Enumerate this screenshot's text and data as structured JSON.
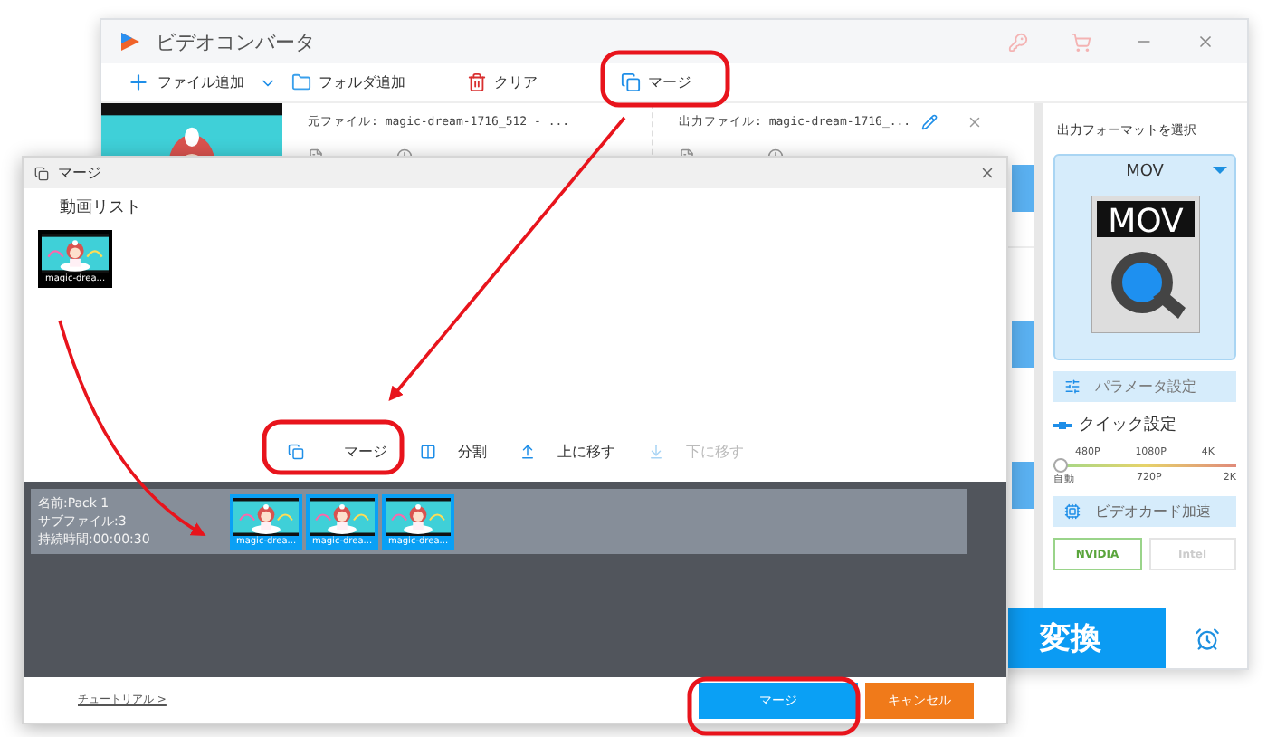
{
  "main_window": {
    "title": "ビデオコンバータ",
    "toolbar": [
      {
        "kind": "add",
        "label": "ファイル追加"
      },
      {
        "kind": "folder",
        "label": "フォルダ追加"
      },
      {
        "kind": "clear",
        "label": "クリア"
      },
      {
        "kind": "merge",
        "label": "マージ"
      }
    ],
    "file": {
      "source": "元ファイル: magic-dream-1716_512 - ...",
      "output": "出力ファイル: magic-dream-1716_..."
    },
    "format_panel": {
      "heading": "出力フォーマットを選択",
      "format": "MOV",
      "format_icon_text": "MOV",
      "params_button": "パラメータ設定",
      "quick_heading": "クイック設定",
      "quality_top": [
        "480P",
        "1080P",
        "4K"
      ],
      "quality_bottom": [
        "自動",
        "720P",
        "2K"
      ],
      "level": 0,
      "gpu_heading": "ビデオカード加速",
      "gpus": [
        {
          "label": "NVIDIA",
          "selected": true
        },
        {
          "label": "Intel",
          "selected": false
        }
      ]
    },
    "convert_button": "変換"
  },
  "dialog": {
    "title": "マージ",
    "list_heading": "動画リスト",
    "video_list": [
      {
        "kind": "picture",
        "caption": "magic-drea..."
      }
    ],
    "actions": [
      {
        "kind": "merge",
        "label": "マージ",
        "disabled": false
      },
      {
        "kind": "split",
        "label": "分割",
        "disabled": false
      },
      {
        "kind": "up",
        "label": "上に移す",
        "disabled": false
      },
      {
        "kind": "down",
        "label": "下に移す",
        "disabled": true
      }
    ],
    "pack": {
      "name": "名前:Pack 1",
      "subfiles": "サブファイル:3",
      "duration": "持続時間:00:00:30",
      "clips": [
        {
          "kind": "picture",
          "caption": "magic-drea...",
          "selected": true
        },
        {
          "kind": "picture",
          "caption": "magic-drea...",
          "selected": true
        },
        {
          "kind": "picture",
          "caption": "magic-drea...",
          "selected": true
        }
      ]
    },
    "tutorial_link": "チュートリアル >",
    "merge_button": "マージ",
    "cancel_button": "キャンセル"
  }
}
